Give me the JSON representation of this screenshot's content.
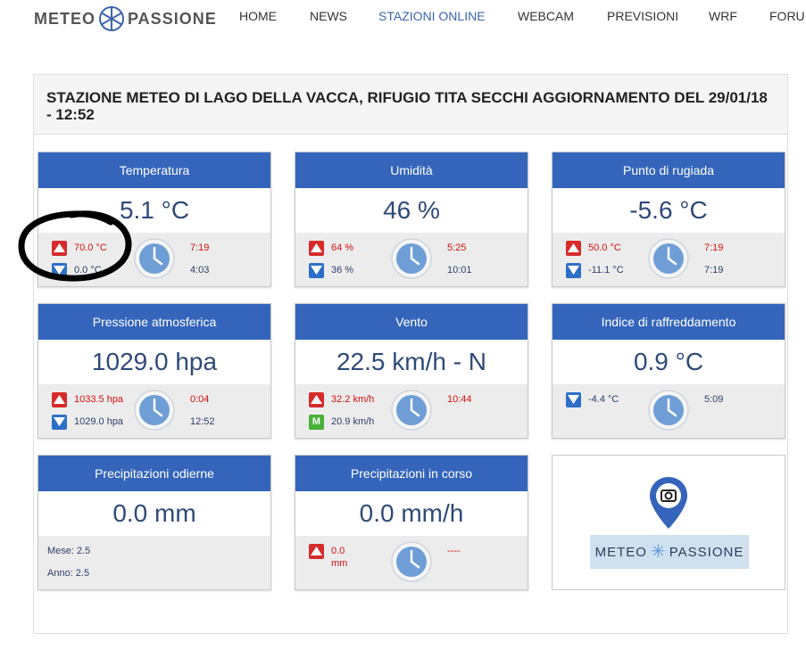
{
  "header": {
    "logo_left": "METEO",
    "logo_right": "PASSIONE",
    "nav": [
      {
        "label": "HOME",
        "active": false
      },
      {
        "label": "NEWS",
        "active": false
      },
      {
        "label": "STAZIONI ONLINE",
        "active": true
      },
      {
        "label": "WEBCAM",
        "active": false
      },
      {
        "label": "PREVISIONI",
        "active": false
      },
      {
        "label": "WRF",
        "active": false
      },
      {
        "label": "FORU",
        "active": false
      }
    ]
  },
  "page": {
    "title": "STAZIONE METEO DI LAGO DELLA VACCA, RIFUGIO TITA SECCHI AGGIORNAMENTO DEL 29/01/18 - 12:52"
  },
  "cards": {
    "temperatura": {
      "title": "Temperatura",
      "value": "5.1 °C",
      "max": "70.0 °C",
      "max_time": "7:19",
      "min": "0.0 °C",
      "min_time": "4:03"
    },
    "umidita": {
      "title": "Umidità",
      "value": "46 %",
      "max": "64 %",
      "max_time": "5:25",
      "min": "36 %",
      "min_time": "10:01"
    },
    "rugiada": {
      "title": "Punto di rugiada",
      "value": "-5.6 °C",
      "max": "50.0 °C",
      "max_time": "7:19",
      "min": "-11.1 °C",
      "min_time": "7:19"
    },
    "pressione": {
      "title": "Pressione atmosferica",
      "value": "1029.0 hpa",
      "max": "1033.5 hpa",
      "max_time": "0:04",
      "min": "1029.0 hpa",
      "min_time": "12:52"
    },
    "vento": {
      "title": "Vento",
      "value": "22.5 km/h - N",
      "max": "32.2 km/h",
      "max_time": "10:44",
      "mean_icon": "M",
      "mean": "20.9 km/h"
    },
    "raffreddamento": {
      "title": "Indice di raffreddamento",
      "value": "0.9 °C",
      "min": "-4.4 °C",
      "min_time": "5:09"
    },
    "precip_odierne": {
      "title": "Precipitazioni odierne",
      "value": "0.0 mm",
      "mese": "Mese: 2.5",
      "anno": "Anno: 2.5"
    },
    "precip_corso": {
      "title": "Precipitazioni in corso",
      "value": "0.0 mm/h",
      "max_line1": "0.0",
      "max_line2": "mm",
      "max_time": "----"
    }
  },
  "brand_box": {
    "left": "METEO",
    "right": "PASSIONE"
  },
  "colors": {
    "accent": "#3565bb",
    "nav_active": "#3a64ad",
    "max_red": "#d41010",
    "value_blue": "#2f4a78"
  },
  "annotation": "hand-drawn black circle around temperature max/min"
}
